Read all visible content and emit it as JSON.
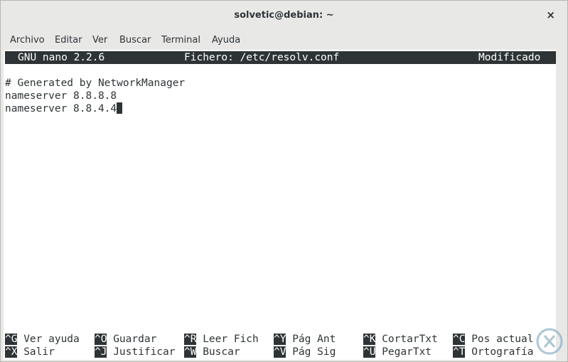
{
  "window": {
    "title": "solvetic@debian: ~",
    "close_glyph": "×"
  },
  "menubar": {
    "items": [
      "Archivo",
      "Editar",
      "Ver",
      "Buscar",
      "Terminal",
      "Ayuda"
    ]
  },
  "nano": {
    "version": "GNU nano 2.2.6",
    "file": "Fichero: /etc/resolv.conf",
    "status": "Modificado",
    "lines": [
      "# Generated by NetworkManager",
      "nameserver 8.8.8.8",
      "nameserver 8.8.4.4"
    ]
  },
  "shortcuts": {
    "row1": [
      {
        "key": "^G",
        "label": "Ver ayuda"
      },
      {
        "key": "^O",
        "label": "Guardar"
      },
      {
        "key": "^R",
        "label": "Leer Fich"
      },
      {
        "key": "^Y",
        "label": "Pág Ant"
      },
      {
        "key": "^K",
        "label": "CortarTxt"
      },
      {
        "key": "^C",
        "label": "Pos actual"
      }
    ],
    "row2": [
      {
        "key": "^X",
        "label": "Salir"
      },
      {
        "key": "^J",
        "label": "Justificar"
      },
      {
        "key": "^W",
        "label": "Buscar"
      },
      {
        "key": "^V",
        "label": "Pág Sig"
      },
      {
        "key": "^U",
        "label": "PegarTxt"
      },
      {
        "key": "^T",
        "label": "Ortografía"
      }
    ]
  },
  "colors": {
    "header_bg": "#2e3436",
    "terminal_bg": "#ffffff",
    "chrome_bg": "#e8e8e7"
  }
}
